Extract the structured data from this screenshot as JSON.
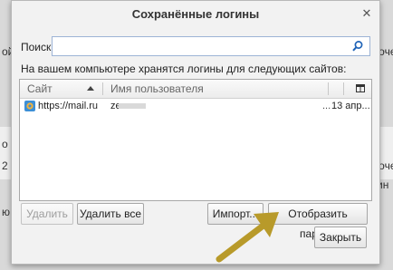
{
  "background": {
    "left_texts": [
      "ой",
      "о",
      "2",
      "ю"
    ],
    "right_texts": [
      "апочет",
      "ам",
      "апочет",
      "ргин"
    ]
  },
  "dialog": {
    "title": "Сохранённые логины",
    "close_glyph": "✕"
  },
  "search": {
    "label": "Поиск:",
    "value": ""
  },
  "info_text": "На вашем компьютере хранятся логины для следующих сайтов:",
  "table": {
    "columns": [
      "Сайт",
      "Имя пользователя"
    ],
    "rows": [
      {
        "site": "https://mail.ru",
        "user": "ze",
        "dots": "...",
        "date": "13 апр..."
      }
    ]
  },
  "buttons": {
    "delete": "Удалить",
    "delete_all": "Удалить все",
    "import": "Импорт...",
    "show_passwords": "Отобразить пароли",
    "close": "Закрыть"
  },
  "colors": {
    "arrow": "#b89a2a",
    "search_border": "#9db4d6"
  }
}
